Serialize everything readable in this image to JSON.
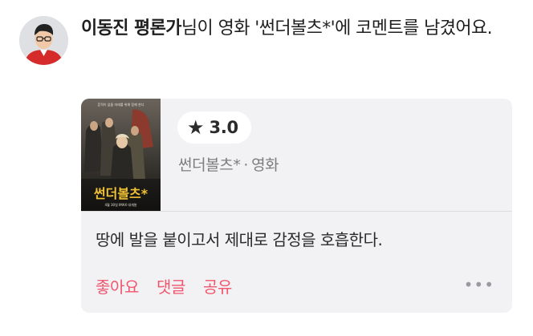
{
  "header": {
    "author_name": "이동진 평론가",
    "headline_rest": "님이 영화 '썬더볼츠*'에 코멘트를 남겼어요."
  },
  "card": {
    "poster": {
      "title_art": "썬더볼츠*",
      "tagline": "흔적이 없을 미래를 위해 함께 한다",
      "release_line": "4월 30일 IMAX 대개봉"
    },
    "rating": {
      "icon": "star-icon",
      "value": "3.0"
    },
    "movie": {
      "title": "썬더볼츠*",
      "separator": "·",
      "category": "영화"
    },
    "comment": "땅에 발을 붙이고서 제대로 감정을 호흡한다.",
    "actions": {
      "like": "좋아요",
      "reply": "댓글",
      "share": "공유"
    },
    "more_icon": "more-horizontal-icon"
  },
  "colors": {
    "accent": "#f0566d",
    "card_bg": "#f2f2f4",
    "meta_text": "#7d7d80"
  }
}
